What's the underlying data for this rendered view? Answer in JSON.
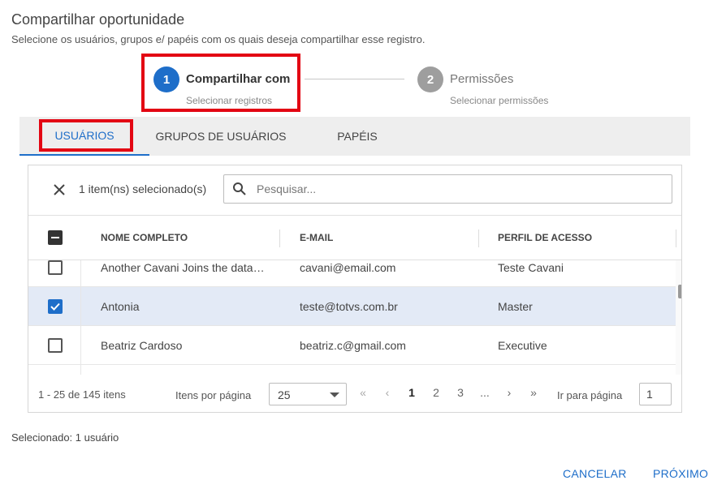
{
  "header": {
    "title": "Compartilhar oportunidade",
    "subtitle": "Selecione os usuários, grupos e/ papéis com os quais deseja compartilhar esse registro."
  },
  "stepper": {
    "steps": [
      {
        "number": "1",
        "title": "Compartilhar com",
        "subtitle": "Selecionar registros",
        "state": "active"
      },
      {
        "number": "2",
        "title": "Permissões",
        "subtitle": "Selecionar permissões",
        "state": "inactive"
      }
    ]
  },
  "tabs": [
    {
      "label": "USUÁRIOS",
      "active": true
    },
    {
      "label": "GRUPOS DE USUÁRIOS",
      "active": false
    },
    {
      "label": "PAPÉIS",
      "active": false
    }
  ],
  "toolbar": {
    "selected_count": "1 item(ns) selecionado(s)",
    "search_placeholder": "Pesquisar..."
  },
  "table": {
    "columns": [
      "NOME COMPLETO",
      "E-MAIL",
      "PERFIL DE ACESSO"
    ],
    "rows": [
      {
        "name": "Another Cavani Joins the data…",
        "email": "cavani@email.com",
        "profile": "Teste Cavani",
        "checked": false
      },
      {
        "name": "Antonia",
        "email": "teste@totvs.com.br",
        "profile": "Master",
        "checked": true
      },
      {
        "name": "Beatriz Cardoso",
        "email": "beatriz.c@gmail.com",
        "profile": "Executive",
        "checked": false
      }
    ]
  },
  "pagination": {
    "range": "1 - 25 de 145 itens",
    "items_per_page_label": "Itens por página",
    "items_per_page_value": "25",
    "first": "«",
    "prev": "‹",
    "pages": [
      "1",
      "2",
      "3",
      "..."
    ],
    "next": "›",
    "last": "»",
    "goto_label": "Ir para página",
    "goto_value": "1"
  },
  "selected_note": "Selecionado: 1 usuário",
  "actions": {
    "cancel": "CANCELAR",
    "next": "PRÓXIMO"
  },
  "colors": {
    "accent": "#1e6ec9",
    "highlight": "#e30613",
    "step_inactive": "#9e9e9e"
  }
}
